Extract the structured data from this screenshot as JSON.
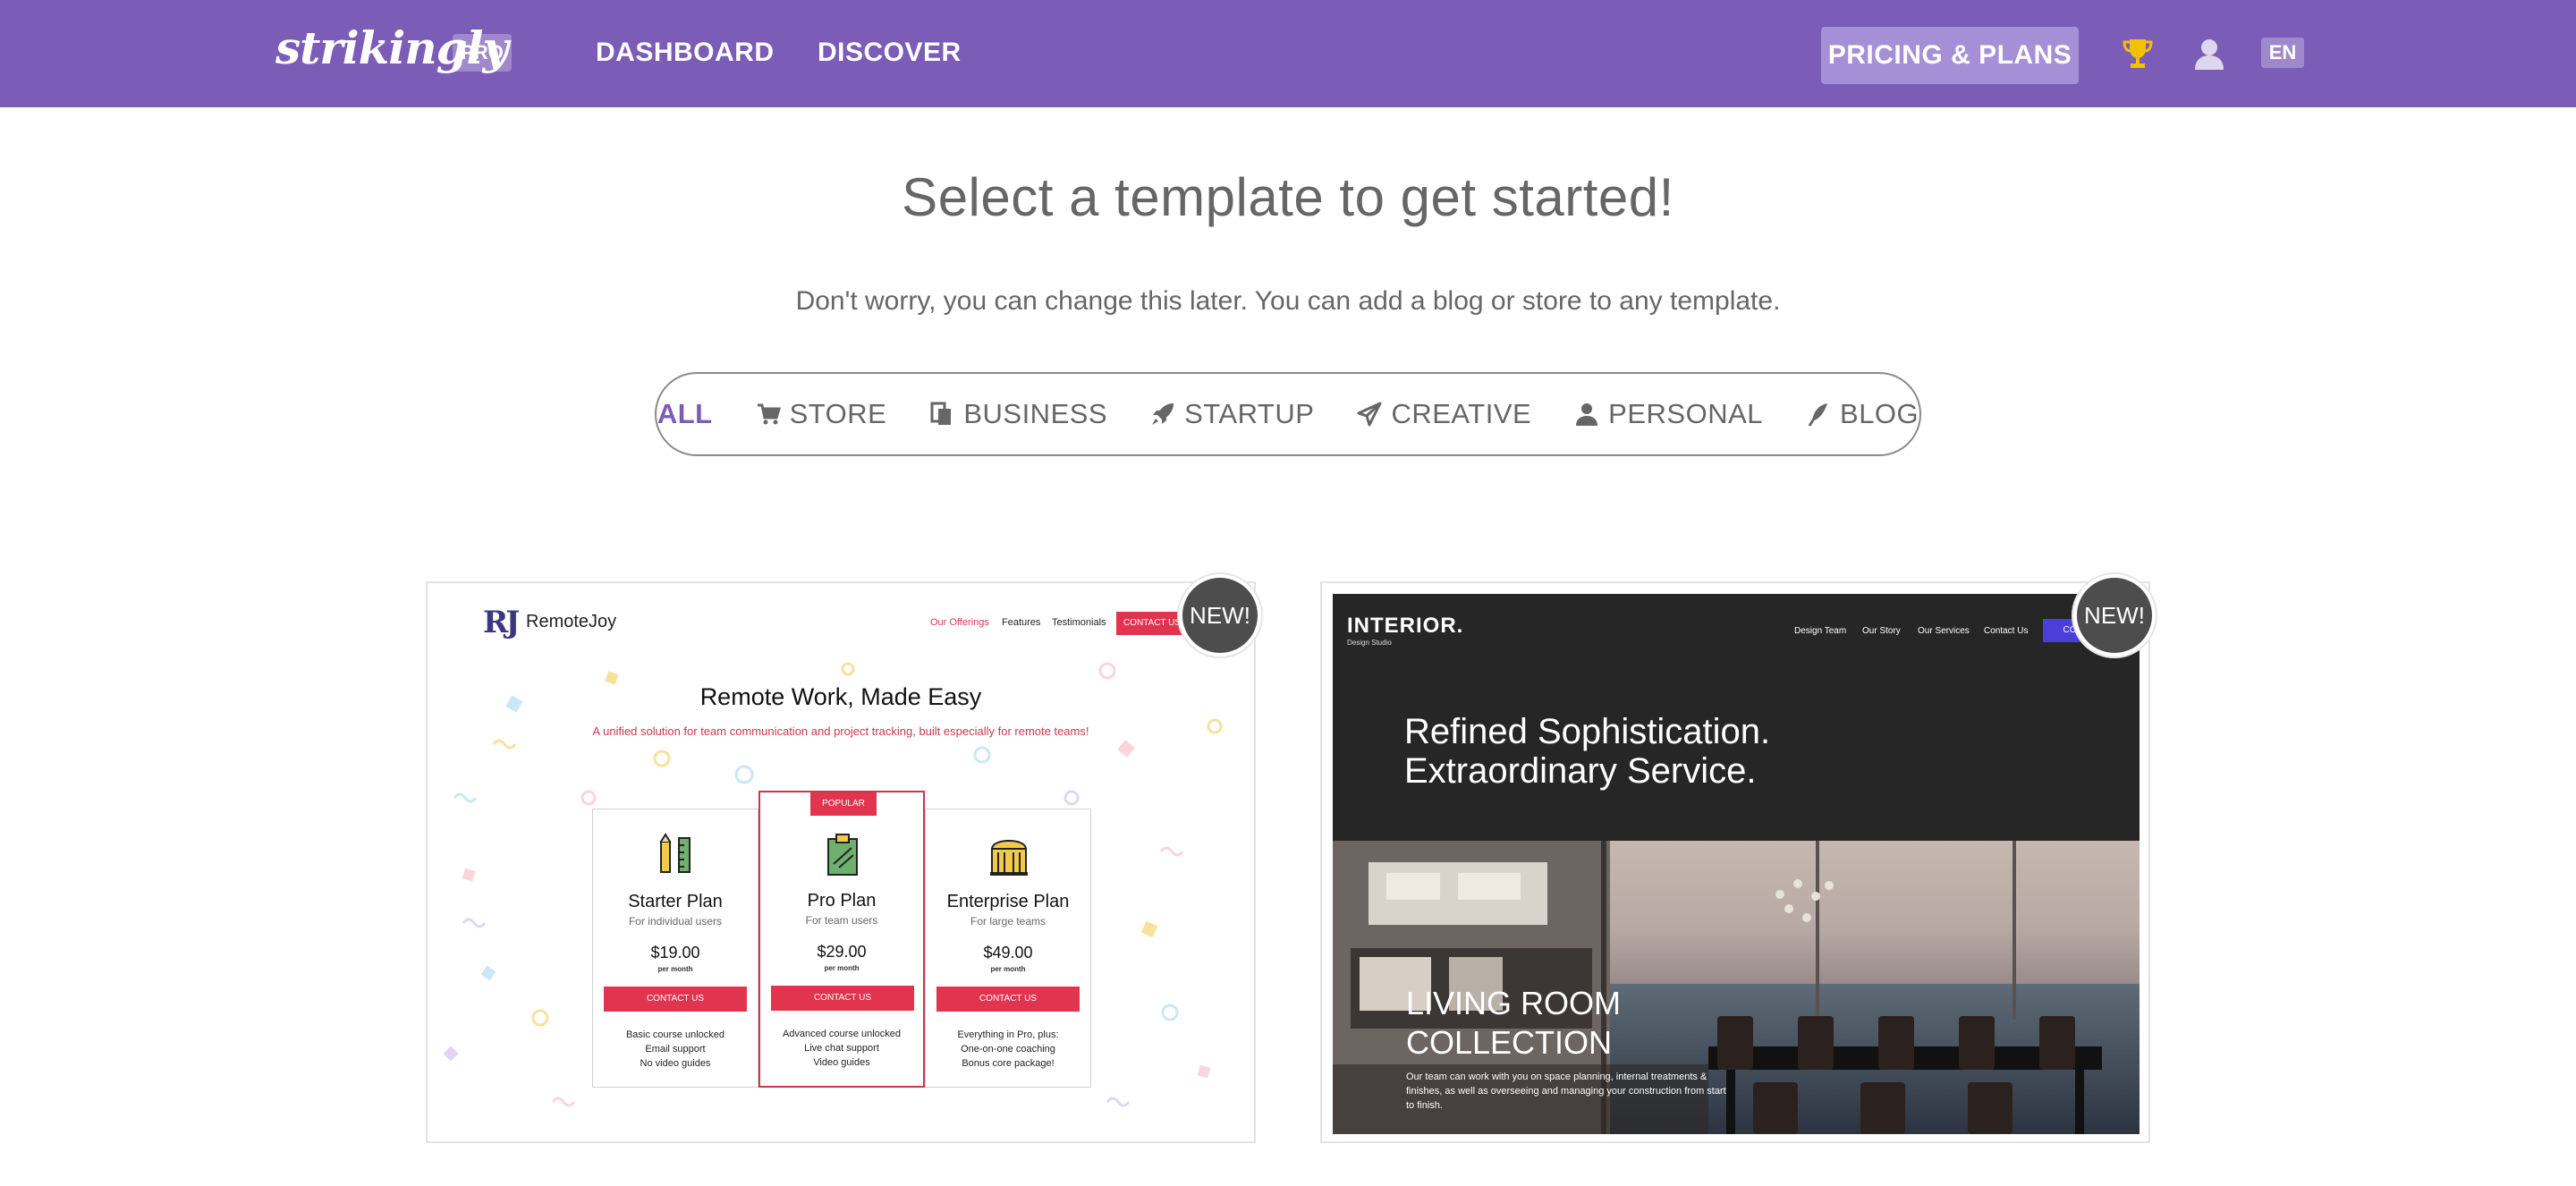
{
  "nav": {
    "logo": "strikingly",
    "pro_badge": "PRO",
    "dashboard": "DASHBOARD",
    "discover": "DISCOVER",
    "pricing": "PRICING & PLANS",
    "lang": "EN"
  },
  "header": {
    "title": "Select a template to get started!",
    "subtitle": "Don't worry, you can change this later. You can add a blog or store to any template."
  },
  "filters": [
    {
      "label": "ALL",
      "icon": "none",
      "active": true
    },
    {
      "label": "STORE",
      "icon": "cart-icon"
    },
    {
      "label": "BUSINESS",
      "icon": "document-icon"
    },
    {
      "label": "STARTUP",
      "icon": "rocket-icon"
    },
    {
      "label": "CREATIVE",
      "icon": "paper-plane-icon"
    },
    {
      "label": "PERSONAL",
      "icon": "person-icon"
    },
    {
      "label": "BLOG",
      "icon": "quill-icon"
    }
  ],
  "templates": [
    {
      "badge": "NEW!",
      "preview": {
        "logo_mark": "RJ",
        "logo_text": "RemoteJoy",
        "nav": [
          "Our Offerings",
          "Features",
          "Testimonials"
        ],
        "nav_cta": "CONTACT US",
        "headline": "Remote Work, Made Easy",
        "subline": "A unified solution for team communication and project tracking, built especially for remote teams!",
        "plans": [
          {
            "name": "Starter Plan",
            "for": "For individual users",
            "price": "$19.00",
            "per": "per month",
            "button": "CONTACT US",
            "features": [
              "Basic course unlocked",
              "Email support",
              "No video guides"
            ]
          },
          {
            "name": "Pro Plan",
            "for": "For team users",
            "price": "$29.00",
            "per": "per month",
            "button": "CONTACT US",
            "tag": "POPULAR",
            "features": [
              "Advanced course unlocked",
              "Live chat support",
              "Video guides"
            ]
          },
          {
            "name": "Enterprise Plan",
            "for": "For large teams",
            "price": "$49.00",
            "per": "per month",
            "button": "CONTACT US",
            "features": [
              "Everything in Pro, plus:",
              "One-on-one coaching",
              "Bonus core package!"
            ]
          }
        ]
      }
    },
    {
      "badge": "NEW!",
      "preview": {
        "logo": "INTERIOR.",
        "logo_sub": "Design Studio",
        "nav": [
          "Design Team",
          "Our Story",
          "Our Services",
          "Contact Us"
        ],
        "nav_cta": "CO",
        "headline_1": "Refined Sophistication.",
        "headline_2": "Extraordinary Service.",
        "section_1": "LIVING ROOM",
        "section_2": "COLLECTION",
        "body": "Our team can work with you on space planning, internal treatments & finishes, as well as overseeing and managing your construction from start to finish."
      }
    }
  ],
  "colors": {
    "brand": "#7b5cb6",
    "accent_red": "#e0344f"
  }
}
